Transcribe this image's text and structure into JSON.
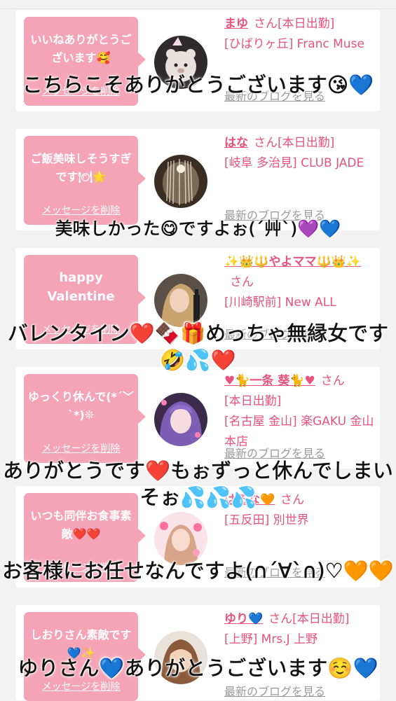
{
  "delete_label": "メッセージを削除",
  "blog_label": "最新のブログを見る",
  "san": "さん",
  "cards": [
    {
      "message": "いいねありがとうございます🥰",
      "name": "まゆ",
      "status": "[本日出勤]",
      "shop": "[ひばりヶ丘] Franc Muse",
      "overlay": "こちらこそありがとうございます😘💙"
    },
    {
      "message": "ご飯美味しそうすぎです🍽🌟",
      "name": "はな",
      "status": "[本日出勤]",
      "shop": "[岐阜 多治見] CLUB JADE",
      "overlay": "美味しかった😋ですよぉ(´艸`)💜💙"
    },
    {
      "message": "happy Valentine",
      "name": "✨👑🔱やよママ🔱👑✨",
      "status": "",
      "shop": "[川崎駅前] New ALL",
      "overlay": "バレンタイン❤️🍫🎁めっちゃ無縁女です🤣💦❤️"
    },
    {
      "message": "ゆっくり休んで(*´﹀`*)❊",
      "name": "♥🐈一条 葵🐈♥",
      "status": "[本日出勤]",
      "shop": "[名古屋 金山] 楽GAKU 金山本店",
      "overlay": "ありがとうです❤️もぉずっと休んでしまいそぉ💦💦💦"
    },
    {
      "message": "いつも同伴お食事素敵❤️❤️",
      "name": "はるな🧡",
      "status": "",
      "shop": "[五反田] 別世界",
      "overlay": "お客様にお任せなんですよ(∩´∀`∩)♡🧡🧡"
    },
    {
      "message": "しおりさん素敵です💙✨",
      "name": "ゆり💙",
      "status": "[本日出勤]",
      "shop": "[上野] Mrs.J 上野",
      "overlay": "ゆりさん💙ありがとうございます☺️💙"
    }
  ]
}
